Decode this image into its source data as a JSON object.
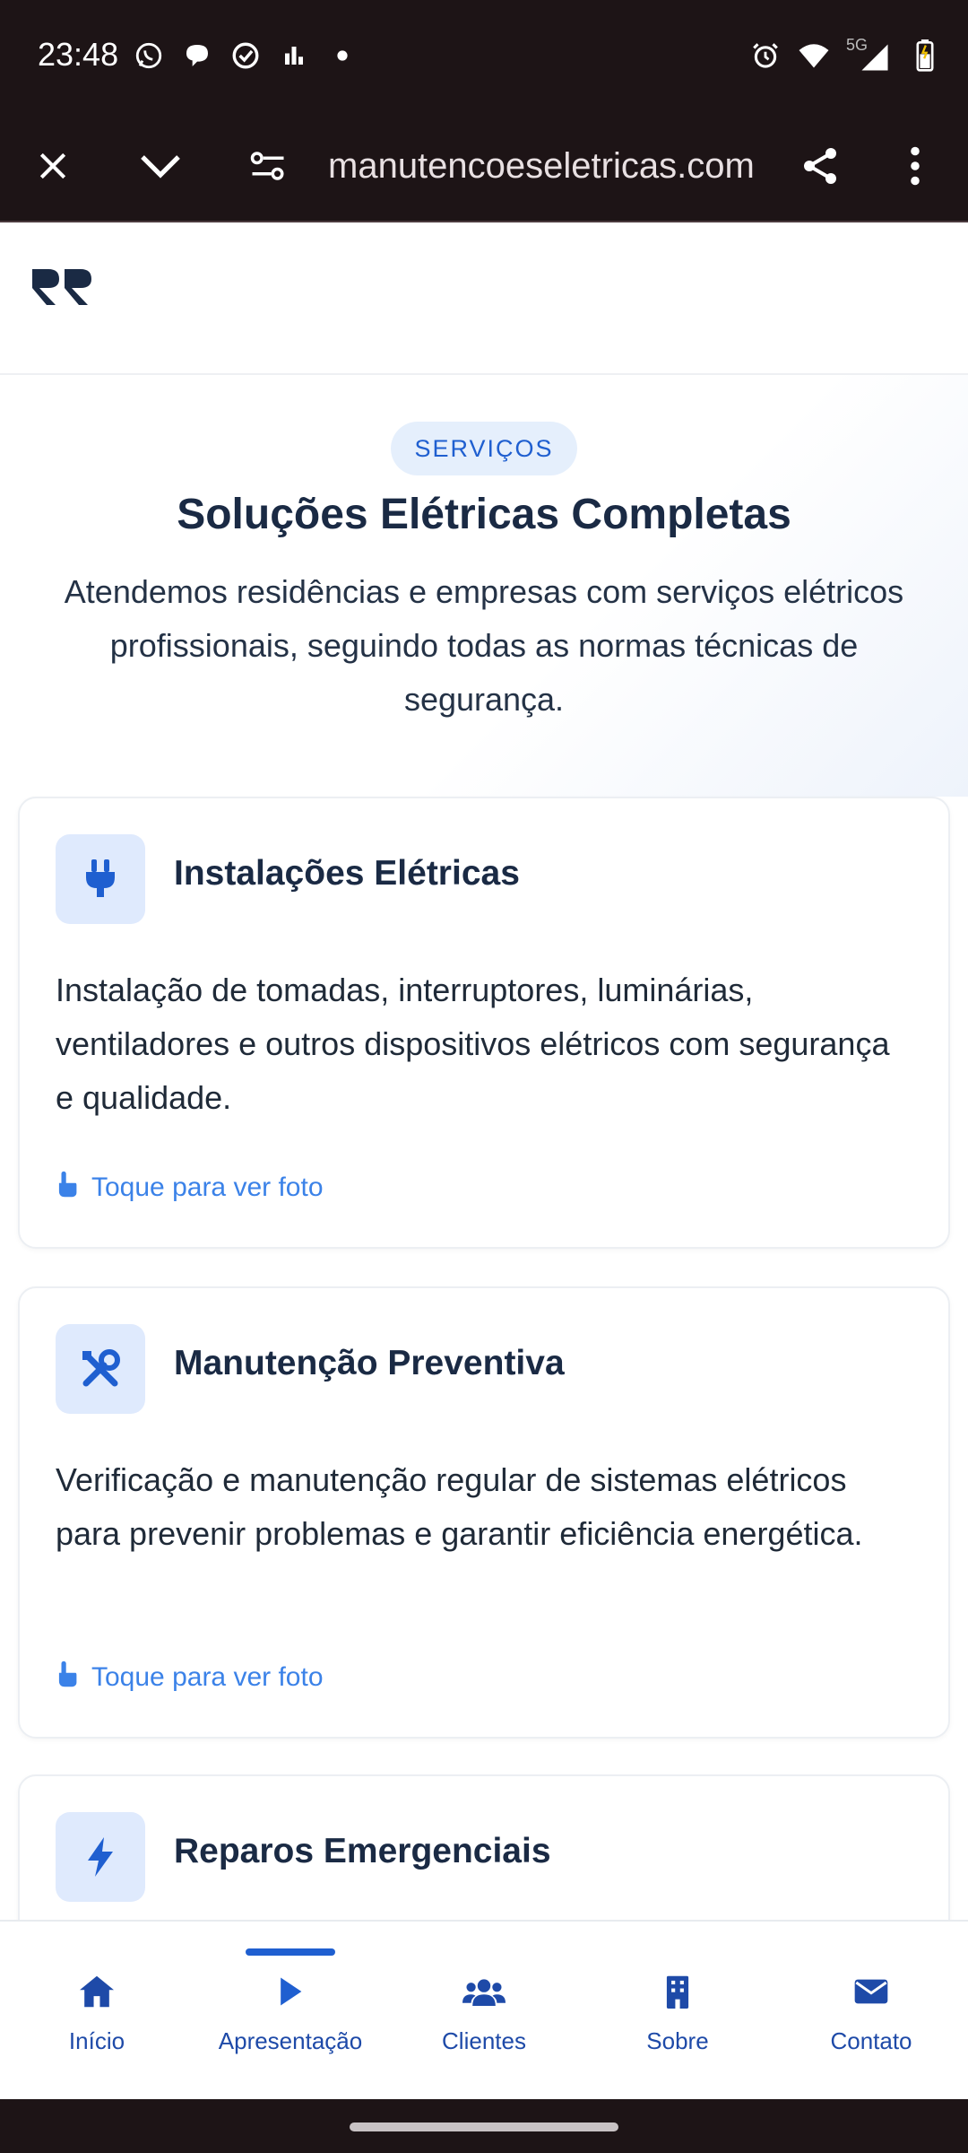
{
  "status_bar": {
    "time": "23:48",
    "network_label": "5G",
    "left_icons": [
      "whatsapp-icon",
      "chat-bubble-icon",
      "check-circle-icon",
      "bar-chart-icon",
      "dot-icon"
    ],
    "right_icons": [
      "alarm-icon",
      "wifi-icon",
      "signal-icon",
      "battery-icon"
    ]
  },
  "browser": {
    "url": "manutencoeseletricas.com",
    "icons": [
      "close-icon",
      "chevron-down-icon",
      "site-settings-icon",
      "share-icon",
      "more-vert-icon"
    ]
  },
  "hero": {
    "badge": "SERVIÇOS",
    "title": "Soluções Elétricas Completas",
    "subtitle": "Atendemos residências e empresas com serviços elétricos profissionais, seguindo todas as normas técnicas de segurança."
  },
  "cards": [
    {
      "icon": "plug-icon",
      "title": "Instalações Elétricas",
      "description": "Instalação de tomadas, interruptores, luminárias, ventiladores e outros dispositivos elétricos com segurança e qualidade.",
      "link": "Toque para ver foto"
    },
    {
      "icon": "tools-icon",
      "title": "Manutenção Preventiva",
      "description": "Verificação e manutenção regular de sistemas elétricos para prevenir problemas e garantir eficiência energética.",
      "link": "Toque para ver foto"
    },
    {
      "icon": "bolt-icon",
      "title": "Reparos Emergenciais"
    }
  ],
  "bottom_nav": {
    "active": "Apresentação",
    "items": [
      {
        "label": "Início",
        "icon": "home-icon"
      },
      {
        "label": "Apresentação",
        "icon": "play-icon"
      },
      {
        "label": "Clientes",
        "icon": "users-icon"
      },
      {
        "label": "Sobre",
        "icon": "building-icon"
      },
      {
        "label": "Contato",
        "icon": "envelope-icon"
      }
    ]
  },
  "colors": {
    "brand_blue": "#1f5fd0",
    "link_blue": "#3b82e8",
    "heading": "#1a2a44",
    "system_bar": "#1d1416"
  }
}
